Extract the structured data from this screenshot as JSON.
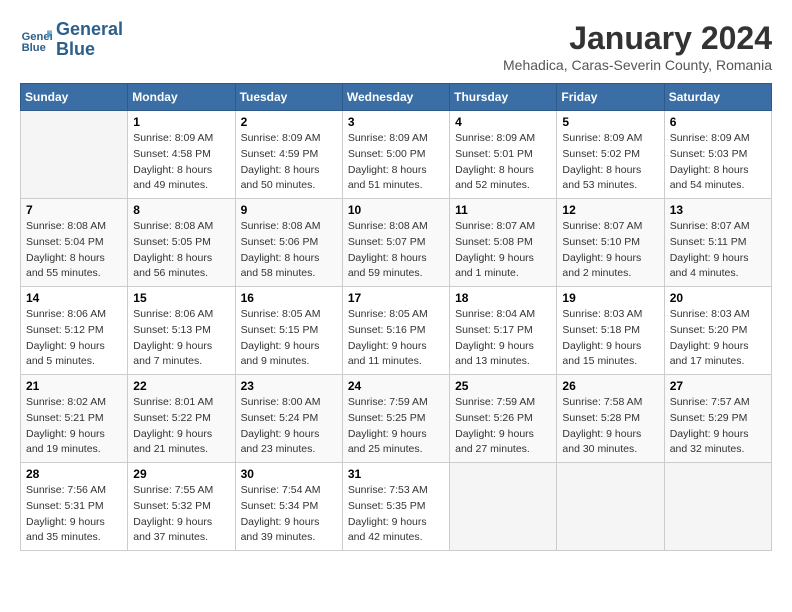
{
  "header": {
    "logo": {
      "line1": "General",
      "line2": "Blue"
    },
    "month": "January 2024",
    "location": "Mehadica, Caras-Severin County, Romania"
  },
  "days_of_week": [
    "Sunday",
    "Monday",
    "Tuesday",
    "Wednesday",
    "Thursday",
    "Friday",
    "Saturday"
  ],
  "weeks": [
    [
      {
        "num": "",
        "sunrise": "",
        "sunset": "",
        "daylight": ""
      },
      {
        "num": "1",
        "sunrise": "Sunrise: 8:09 AM",
        "sunset": "Sunset: 4:58 PM",
        "daylight": "Daylight: 8 hours and 49 minutes."
      },
      {
        "num": "2",
        "sunrise": "Sunrise: 8:09 AM",
        "sunset": "Sunset: 4:59 PM",
        "daylight": "Daylight: 8 hours and 50 minutes."
      },
      {
        "num": "3",
        "sunrise": "Sunrise: 8:09 AM",
        "sunset": "Sunset: 5:00 PM",
        "daylight": "Daylight: 8 hours and 51 minutes."
      },
      {
        "num": "4",
        "sunrise": "Sunrise: 8:09 AM",
        "sunset": "Sunset: 5:01 PM",
        "daylight": "Daylight: 8 hours and 52 minutes."
      },
      {
        "num": "5",
        "sunrise": "Sunrise: 8:09 AM",
        "sunset": "Sunset: 5:02 PM",
        "daylight": "Daylight: 8 hours and 53 minutes."
      },
      {
        "num": "6",
        "sunrise": "Sunrise: 8:09 AM",
        "sunset": "Sunset: 5:03 PM",
        "daylight": "Daylight: 8 hours and 54 minutes."
      }
    ],
    [
      {
        "num": "7",
        "sunrise": "Sunrise: 8:08 AM",
        "sunset": "Sunset: 5:04 PM",
        "daylight": "Daylight: 8 hours and 55 minutes."
      },
      {
        "num": "8",
        "sunrise": "Sunrise: 8:08 AM",
        "sunset": "Sunset: 5:05 PM",
        "daylight": "Daylight: 8 hours and 56 minutes."
      },
      {
        "num": "9",
        "sunrise": "Sunrise: 8:08 AM",
        "sunset": "Sunset: 5:06 PM",
        "daylight": "Daylight: 8 hours and 58 minutes."
      },
      {
        "num": "10",
        "sunrise": "Sunrise: 8:08 AM",
        "sunset": "Sunset: 5:07 PM",
        "daylight": "Daylight: 8 hours and 59 minutes."
      },
      {
        "num": "11",
        "sunrise": "Sunrise: 8:07 AM",
        "sunset": "Sunset: 5:08 PM",
        "daylight": "Daylight: 9 hours and 1 minute."
      },
      {
        "num": "12",
        "sunrise": "Sunrise: 8:07 AM",
        "sunset": "Sunset: 5:10 PM",
        "daylight": "Daylight: 9 hours and 2 minutes."
      },
      {
        "num": "13",
        "sunrise": "Sunrise: 8:07 AM",
        "sunset": "Sunset: 5:11 PM",
        "daylight": "Daylight: 9 hours and 4 minutes."
      }
    ],
    [
      {
        "num": "14",
        "sunrise": "Sunrise: 8:06 AM",
        "sunset": "Sunset: 5:12 PM",
        "daylight": "Daylight: 9 hours and 5 minutes."
      },
      {
        "num": "15",
        "sunrise": "Sunrise: 8:06 AM",
        "sunset": "Sunset: 5:13 PM",
        "daylight": "Daylight: 9 hours and 7 minutes."
      },
      {
        "num": "16",
        "sunrise": "Sunrise: 8:05 AM",
        "sunset": "Sunset: 5:15 PM",
        "daylight": "Daylight: 9 hours and 9 minutes."
      },
      {
        "num": "17",
        "sunrise": "Sunrise: 8:05 AM",
        "sunset": "Sunset: 5:16 PM",
        "daylight": "Daylight: 9 hours and 11 minutes."
      },
      {
        "num": "18",
        "sunrise": "Sunrise: 8:04 AM",
        "sunset": "Sunset: 5:17 PM",
        "daylight": "Daylight: 9 hours and 13 minutes."
      },
      {
        "num": "19",
        "sunrise": "Sunrise: 8:03 AM",
        "sunset": "Sunset: 5:18 PM",
        "daylight": "Daylight: 9 hours and 15 minutes."
      },
      {
        "num": "20",
        "sunrise": "Sunrise: 8:03 AM",
        "sunset": "Sunset: 5:20 PM",
        "daylight": "Daylight: 9 hours and 17 minutes."
      }
    ],
    [
      {
        "num": "21",
        "sunrise": "Sunrise: 8:02 AM",
        "sunset": "Sunset: 5:21 PM",
        "daylight": "Daylight: 9 hours and 19 minutes."
      },
      {
        "num": "22",
        "sunrise": "Sunrise: 8:01 AM",
        "sunset": "Sunset: 5:22 PM",
        "daylight": "Daylight: 9 hours and 21 minutes."
      },
      {
        "num": "23",
        "sunrise": "Sunrise: 8:00 AM",
        "sunset": "Sunset: 5:24 PM",
        "daylight": "Daylight: 9 hours and 23 minutes."
      },
      {
        "num": "24",
        "sunrise": "Sunrise: 7:59 AM",
        "sunset": "Sunset: 5:25 PM",
        "daylight": "Daylight: 9 hours and 25 minutes."
      },
      {
        "num": "25",
        "sunrise": "Sunrise: 7:59 AM",
        "sunset": "Sunset: 5:26 PM",
        "daylight": "Daylight: 9 hours and 27 minutes."
      },
      {
        "num": "26",
        "sunrise": "Sunrise: 7:58 AM",
        "sunset": "Sunset: 5:28 PM",
        "daylight": "Daylight: 9 hours and 30 minutes."
      },
      {
        "num": "27",
        "sunrise": "Sunrise: 7:57 AM",
        "sunset": "Sunset: 5:29 PM",
        "daylight": "Daylight: 9 hours and 32 minutes."
      }
    ],
    [
      {
        "num": "28",
        "sunrise": "Sunrise: 7:56 AM",
        "sunset": "Sunset: 5:31 PM",
        "daylight": "Daylight: 9 hours and 35 minutes."
      },
      {
        "num": "29",
        "sunrise": "Sunrise: 7:55 AM",
        "sunset": "Sunset: 5:32 PM",
        "daylight": "Daylight: 9 hours and 37 minutes."
      },
      {
        "num": "30",
        "sunrise": "Sunrise: 7:54 AM",
        "sunset": "Sunset: 5:34 PM",
        "daylight": "Daylight: 9 hours and 39 minutes."
      },
      {
        "num": "31",
        "sunrise": "Sunrise: 7:53 AM",
        "sunset": "Sunset: 5:35 PM",
        "daylight": "Daylight: 9 hours and 42 minutes."
      },
      {
        "num": "",
        "sunrise": "",
        "sunset": "",
        "daylight": ""
      },
      {
        "num": "",
        "sunrise": "",
        "sunset": "",
        "daylight": ""
      },
      {
        "num": "",
        "sunrise": "",
        "sunset": "",
        "daylight": ""
      }
    ]
  ]
}
